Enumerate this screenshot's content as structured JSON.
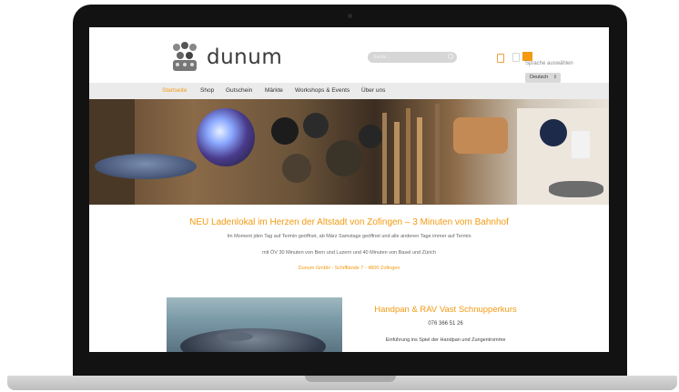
{
  "site": {
    "brand": "dunum"
  },
  "search": {
    "placeholder": "Suche..."
  },
  "language": {
    "label": "Sprache auswählen",
    "selected": "Deutsch"
  },
  "nav": {
    "items": [
      "Startseite",
      "Shop",
      "Gutschein",
      "Märkte",
      "Workshops & Events",
      "Über uns"
    ],
    "active_index": 0
  },
  "announcement": {
    "headline": "NEU Ladenlokal im Herzen der Altstadt von Zofingen – 3 Minuten vom Bahnhof",
    "line1": "Im Moment jden Tag auf Termin geöffnet, ab März Samstags geöffnet und alle anderen Tage immer auf Termin",
    "line2": "mit ÖV 30 Minuten von Bern und Luzern und 40 Minuten von Basel und Zürich",
    "address": "Dunum GmbH - Schifflände 7 - 4800 Zofingen"
  },
  "promo": {
    "title": "Handpan & RAV Vast Schnupperkurs",
    "phone": "076 366 51 26",
    "description": "Einführung ins Spiel der Handpan und Zungentromme"
  },
  "colors": {
    "accent": "#f39a12",
    "nav_bg": "#ebebeb",
    "laptop_bezel": "#121212"
  },
  "icons": [
    "user-icon",
    "cart-icon",
    "search-icon",
    "language-flag-icon"
  ]
}
